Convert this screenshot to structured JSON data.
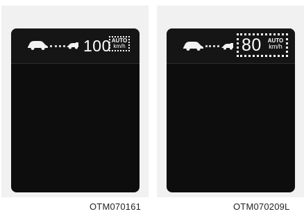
{
  "figures": [
    {
      "speed": "100",
      "auto_label": "AUTO",
      "unit": "km/h",
      "caption": "OTM070161",
      "icons": [
        "vehicle-ahead-icon",
        "distance-dots-icon",
        "own-vehicle-icon"
      ]
    },
    {
      "speed": "80",
      "auto_label": "AUTO",
      "unit": "km/h",
      "caption": "OTM070209L",
      "icons": [
        "vehicle-ahead-icon",
        "distance-dots-icon",
        "own-vehicle-icon"
      ]
    }
  ],
  "colors": {
    "screen": "#0d0d0d",
    "panel": "#f1f1f1",
    "text": "#ffffff",
    "highlight_border": "#ffffff"
  }
}
